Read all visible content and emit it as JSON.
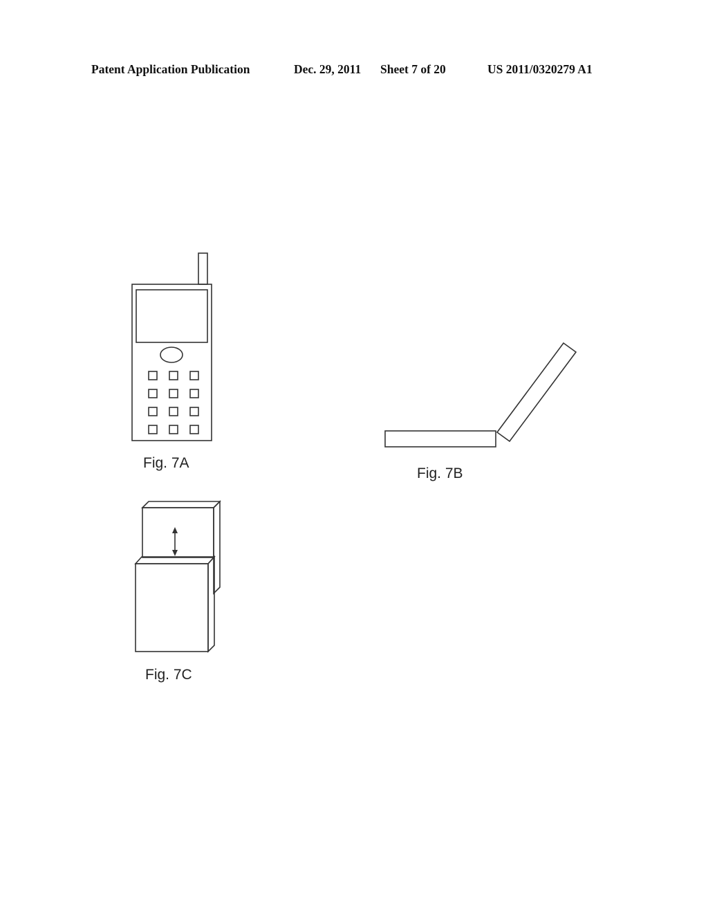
{
  "header": {
    "publication": "Patent Application Publication",
    "date": "Dec. 29, 2011",
    "sheet": "Sheet 7 of 20",
    "number": "US 2011/0320279 A1"
  },
  "figures": [
    {
      "id": "7A",
      "caption": "Fig. 7A",
      "depicts": "candy-bar mobile phone with antenna, screen, navigation button and 12-key keypad"
    },
    {
      "id": "7B",
      "caption": "Fig. 7B",
      "depicts": "clamshell device opened at an angle (side view)"
    },
    {
      "id": "7C",
      "caption": "Fig. 7C",
      "depicts": "slider device with double-headed arrow indicating sliding motion"
    }
  ],
  "keypad": {
    "rows": 4,
    "cols": 3
  }
}
